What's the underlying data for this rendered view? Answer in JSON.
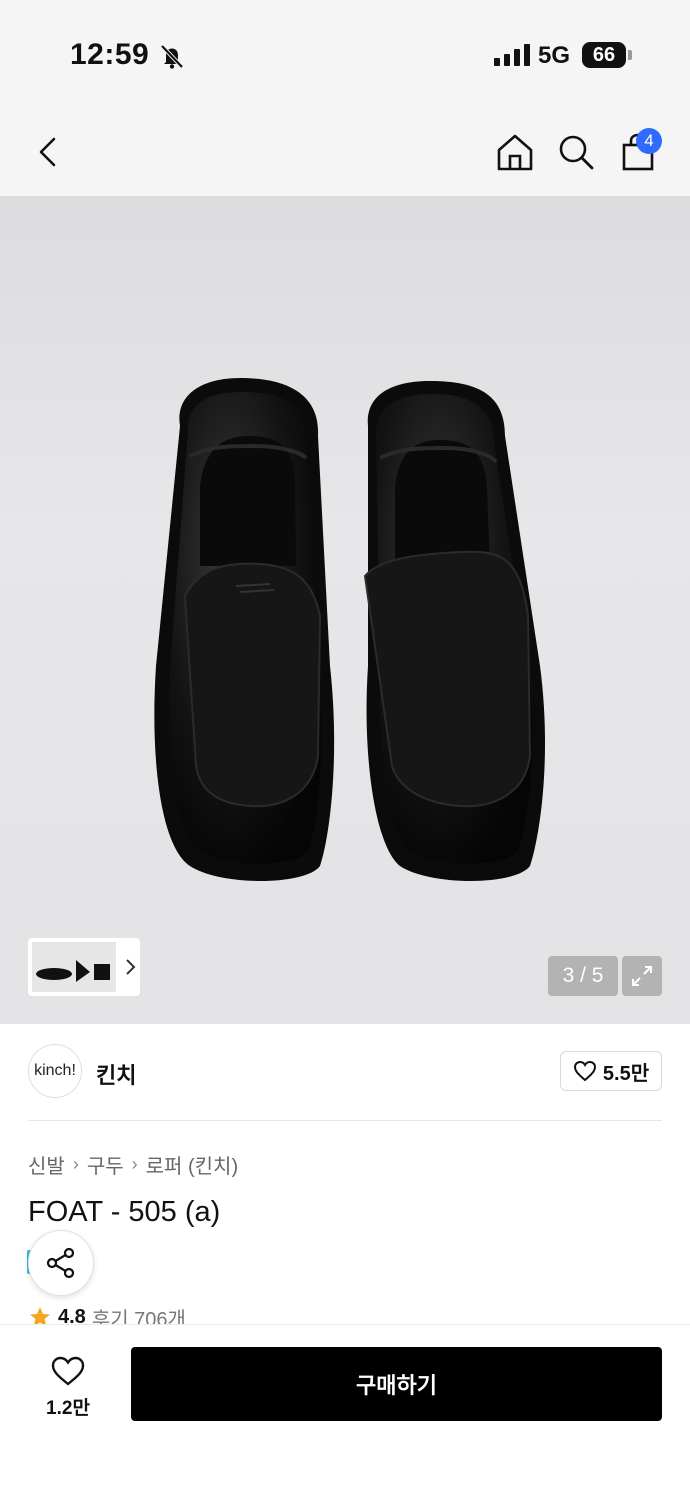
{
  "status": {
    "time": "12:59",
    "network": "5G",
    "battery": "66"
  },
  "nav": {
    "cart_count": "4"
  },
  "gallery": {
    "counter": "3 / 5"
  },
  "brand": {
    "logo_text": "kinch!",
    "name": "킨치",
    "likes": "5.5만"
  },
  "breadcrumb": [
    "신발",
    "구두",
    "로퍼 (킨치)"
  ],
  "product": {
    "title": "FOAT - 505 (a)",
    "rating": "4.8",
    "reviews": "후기 706개"
  },
  "bottom": {
    "like_count": "1.2만",
    "buy_label": "구매하기"
  },
  "colors": {
    "accent_badge": "#2f6bff",
    "buy_button": "#000000",
    "star": "#f5a623"
  },
  "icons": [
    "back-icon",
    "home-icon",
    "search-icon",
    "bag-icon",
    "bell-slash-icon",
    "expand-icon",
    "heart-icon",
    "share-icon",
    "star-icon",
    "chevron-right-icon"
  ]
}
